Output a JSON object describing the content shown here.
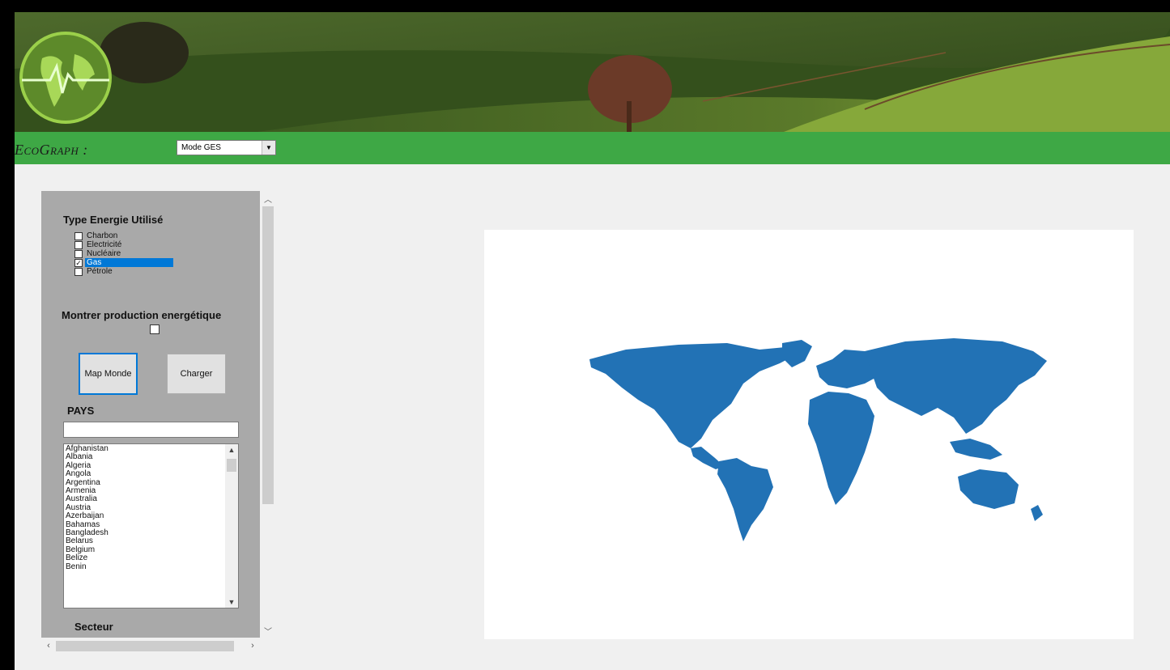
{
  "app": {
    "title": "EcoGraph :",
    "mode_select": {
      "value": "Mode GES"
    }
  },
  "energy": {
    "heading": "Type Energie Utilisé",
    "options": [
      {
        "label": "Charbon",
        "checked": false
      },
      {
        "label": "Electricité",
        "checked": false
      },
      {
        "label": "Nucléaire",
        "checked": false
      },
      {
        "label": "Gas",
        "checked": true
      },
      {
        "label": "Pétrole",
        "checked": false
      }
    ]
  },
  "production": {
    "label": "Montrer production energétique",
    "checked": false
  },
  "buttons": {
    "map": "Map Monde",
    "load": "Charger"
  },
  "country": {
    "heading": "PAYS",
    "search_value": "",
    "list": [
      "Afghanistan",
      "Albania",
      "Algeria",
      "Angola",
      "Argentina",
      "Armenia",
      "Australia",
      "Austria",
      "Azerbaijan",
      "Bahamas",
      "Bangladesh",
      "Belarus",
      "Belgium",
      "Belize",
      "Benin"
    ]
  },
  "sector": {
    "heading": "Secteur"
  },
  "colors": {
    "header_green": "#3ea845",
    "panel_gray": "#a9a9a9",
    "map_blue": "#2272b5",
    "selection_blue": "#0078d7"
  },
  "icons": [
    "globe-logo-icon",
    "dropdown-arrow-icon",
    "checkmark-icon",
    "scroll-up-icon",
    "scroll-down-icon",
    "scroll-left-icon",
    "scroll-right-icon"
  ]
}
